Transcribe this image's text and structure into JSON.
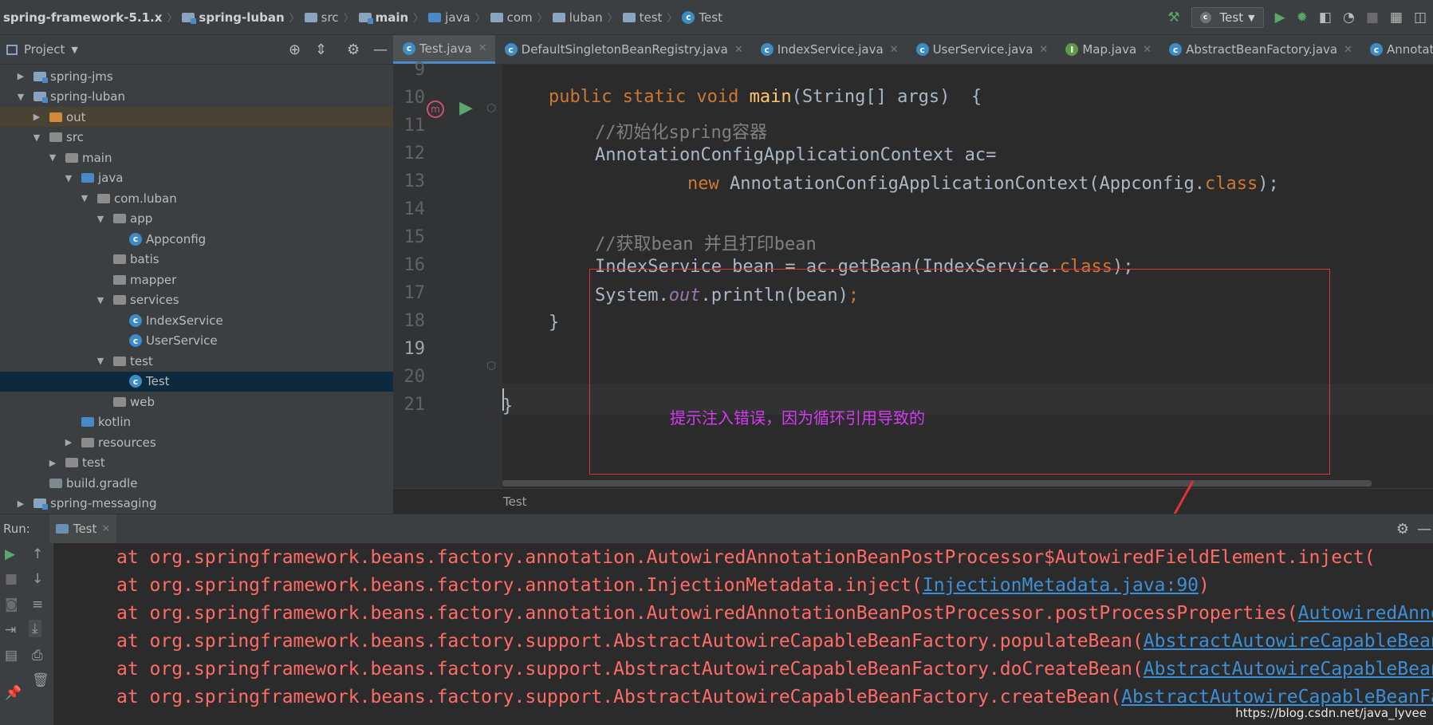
{
  "breadcrumbs": [
    "spring-framework-5.1.x",
    "spring-luban",
    "src",
    "main",
    "java",
    "com",
    "luban",
    "test",
    "Test"
  ],
  "toolbar": {
    "run_config": "Test"
  },
  "project_panel": {
    "title": "Project"
  },
  "tree": [
    {
      "label": "spring-jms",
      "indent": 1,
      "arrow": "▶",
      "icon": "module"
    },
    {
      "label": "spring-luban",
      "indent": 1,
      "arrow": "▼",
      "icon": "module"
    },
    {
      "label": "out",
      "indent": 2,
      "arrow": "▶",
      "icon": "orange-folder"
    },
    {
      "label": "src",
      "indent": 2,
      "arrow": "▼",
      "icon": "folder"
    },
    {
      "label": "main",
      "indent": 3,
      "arrow": "▼",
      "icon": "folder"
    },
    {
      "label": "java",
      "indent": 4,
      "arrow": "▼",
      "icon": "blue-folder"
    },
    {
      "label": "com.luban",
      "indent": 5,
      "arrow": "▼",
      "icon": "package"
    },
    {
      "label": "app",
      "indent": 6,
      "arrow": "▼",
      "icon": "package"
    },
    {
      "label": "Appconfig",
      "indent": 7,
      "arrow": "",
      "icon": "class"
    },
    {
      "label": "batis",
      "indent": 6,
      "arrow": "",
      "icon": "package"
    },
    {
      "label": "mapper",
      "indent": 6,
      "arrow": "",
      "icon": "package"
    },
    {
      "label": "services",
      "indent": 6,
      "arrow": "▼",
      "icon": "package"
    },
    {
      "label": "IndexService",
      "indent": 7,
      "arrow": "",
      "icon": "class"
    },
    {
      "label": "UserService",
      "indent": 7,
      "arrow": "",
      "icon": "class"
    },
    {
      "label": "test",
      "indent": 6,
      "arrow": "▼",
      "icon": "package"
    },
    {
      "label": "Test",
      "indent": 7,
      "arrow": "",
      "icon": "class"
    },
    {
      "label": "web",
      "indent": 6,
      "arrow": "",
      "icon": "package"
    },
    {
      "label": "kotlin",
      "indent": 4,
      "arrow": "",
      "icon": "blue-folder"
    },
    {
      "label": "resources",
      "indent": 4,
      "arrow": "▶",
      "icon": "folder"
    },
    {
      "label": "test",
      "indent": 3,
      "arrow": "▶",
      "icon": "folder"
    },
    {
      "label": "build.gradle",
      "indent": 2,
      "arrow": "",
      "icon": "gradle"
    },
    {
      "label": "spring-messaging",
      "indent": 1,
      "arrow": "▶",
      "icon": "module"
    }
  ],
  "tabs": [
    "Test.java",
    "DefaultSingletonBeanRegistry.java",
    "IndexService.java",
    "UserService.java",
    "Map.java",
    "AbstractBeanFactory.java",
    "AnnotationC"
  ],
  "line_numbers": [
    "9",
    "10",
    "11",
    "12",
    "13",
    "14",
    "15",
    "16",
    "17",
    "18",
    "19",
    "20",
    "21"
  ],
  "code": {
    "l10_a": "public static void ",
    "l10_b": "main",
    "l10_c": "(String[] args)  {",
    "l11": "//初始化spring容器",
    "l12": "AnnotationConfigApplicationContext ac=",
    "l13_a": "new ",
    "l13_b": "AnnotationConfigApplicationContext(Appconfig.",
    "l13_c": "class",
    "l13_d": ");",
    "l15": "//获取bean 并且打印bean",
    "l16_a": "IndexService bean = ac.getBean(IndexService.",
    "l16_b": "class",
    "l16_c": ");",
    "l17_a": "System.",
    "l17_b": "out",
    "l17_c": ".println(bean)",
    "l17_d": ";",
    "l18": "}",
    "l21": "}"
  },
  "annotation": "提示注入错误，因为循环引用导致的",
  "editor_footer": "Test",
  "run": {
    "label": "Run:",
    "tab": "Test"
  },
  "stack": [
    {
      "text": "at org.springframework.beans.factory.annotation.AutowiredAnnotationBeanPostProcessor$AutowiredFieldElement.inject(",
      "link": ""
    },
    {
      "text": "at org.springframework.beans.factory.annotation.InjectionMetadata.inject(",
      "link": "InjectionMetadata.java:90",
      "tail": ")"
    },
    {
      "text": "at org.springframework.beans.factory.annotation.AutowiredAnnotationBeanPostProcessor.postProcessProperties(",
      "link": "AutowiredAnnotationBeanPostProcessor.java"
    },
    {
      "text": "at org.springframework.beans.factory.support.AbstractAutowireCapableBeanFactory.populateBean(",
      "link": "AbstractAutowireCapableBeanFactory.java"
    },
    {
      "text": "at org.springframework.beans.factory.support.AbstractAutowireCapableBeanFactory.doCreateBean(",
      "link": "AbstractAutowireCapableBeanFactory.java"
    },
    {
      "text": "at org.springframework.beans.factory.support.AbstractAutowireCapableBeanFactory.createBean(",
      "link": "AbstractAutowireCapableBeanFactory.java"
    }
  ],
  "watermark": "https://blog.csdn.net/java_lyvee"
}
